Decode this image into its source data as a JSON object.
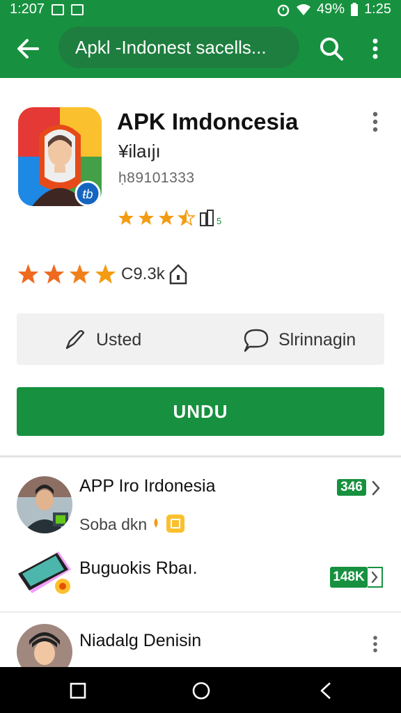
{
  "status_bar": {
    "left_time": "1:207",
    "battery_percent": "49%",
    "right_time": "1:25"
  },
  "app_bar": {
    "search_text": "Apkl -Indonest sacells..."
  },
  "app": {
    "title": "APK Imdoncesia",
    "subtitle": "¥ilaıjı",
    "code": "ḥ89101333",
    "rating_small": 3.5,
    "review_text": "C9.3k",
    "rating_large": 4
  },
  "actions": {
    "left_label": "Usted",
    "right_label": "Slrinnagin",
    "install_label": "UNDU"
  },
  "list": [
    {
      "title": "APP Iro Irdonesia",
      "subtitle": "Soba dkn",
      "badge": "346",
      "has_chevron": true
    },
    {
      "title": "Buguokis Rbaı.",
      "subtitle": "",
      "badge": "148K",
      "has_chevron": true
    },
    {
      "title": "Niadalg Denisin",
      "subtitle": "",
      "badge": "",
      "has_chevron": false
    }
  ],
  "colors": {
    "primary_green": "#17913f",
    "star_orange": "#f39c12"
  }
}
